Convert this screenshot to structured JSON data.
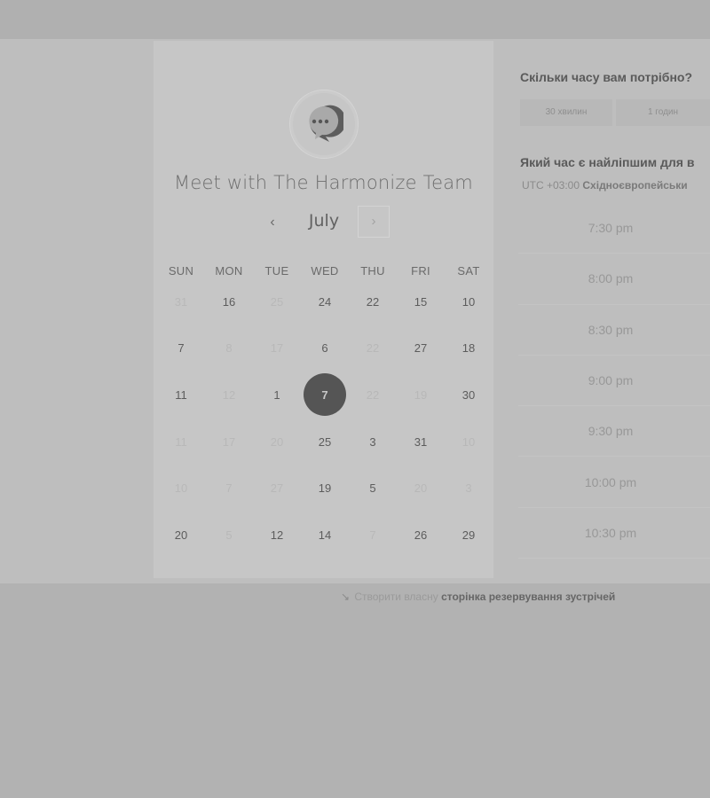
{
  "booking": {
    "title": "Meet with The Harmonize Team",
    "month": "July",
    "prev_icon": "‹",
    "next_icon": "›"
  },
  "calendar": {
    "weekdays": [
      "SUN",
      "MON",
      "TUE",
      "WED",
      "THU",
      "FRI",
      "SAT"
    ],
    "weeks": [
      [
        {
          "d": "31",
          "off": true
        },
        {
          "d": "16",
          "off": false
        },
        {
          "d": "25",
          "off": true
        },
        {
          "d": "24",
          "off": false
        },
        {
          "d": "22",
          "off": false
        },
        {
          "d": "15",
          "off": false
        },
        {
          "d": "10",
          "off": false
        }
      ],
      [
        {
          "d": "7",
          "off": false
        },
        {
          "d": "8",
          "off": true
        },
        {
          "d": "17",
          "off": true
        },
        {
          "d": "6",
          "off": false
        },
        {
          "d": "22",
          "off": true
        },
        {
          "d": "27",
          "off": false
        },
        {
          "d": "18",
          "off": false
        }
      ],
      [
        {
          "d": "11",
          "off": false
        },
        {
          "d": "12",
          "off": true
        },
        {
          "d": "1",
          "off": false
        },
        {
          "d": "7",
          "off": false,
          "selected": true
        },
        {
          "d": "22",
          "off": true
        },
        {
          "d": "19",
          "off": true
        },
        {
          "d": "30",
          "off": false
        }
      ],
      [
        {
          "d": "11",
          "off": true
        },
        {
          "d": "17",
          "off": true
        },
        {
          "d": "20",
          "off": true
        },
        {
          "d": "25",
          "off": false
        },
        {
          "d": "3",
          "off": false
        },
        {
          "d": "31",
          "off": false
        },
        {
          "d": "10",
          "off": true
        }
      ],
      [
        {
          "d": "10",
          "off": true
        },
        {
          "d": "7",
          "off": true
        },
        {
          "d": "27",
          "off": true
        },
        {
          "d": "19",
          "off": false
        },
        {
          "d": "5",
          "off": false
        },
        {
          "d": "20",
          "off": true
        },
        {
          "d": "3",
          "off": true
        }
      ],
      [
        {
          "d": "20",
          "off": false
        },
        {
          "d": "5",
          "off": true
        },
        {
          "d": "12",
          "off": false
        },
        {
          "d": "14",
          "off": false
        },
        {
          "d": "7",
          "off": true
        },
        {
          "d": "26",
          "off": false
        },
        {
          "d": "29",
          "off": false
        }
      ]
    ]
  },
  "duration": {
    "question": "Скільки часу вам потрібно?",
    "options": [
      "30 хвилин",
      "1 годин"
    ]
  },
  "time": {
    "question": "Який час є найліпшим для в",
    "timezone_prefix": "UTC +03:00",
    "timezone_name": "Східноєвропейськи",
    "slots": [
      "7:30 pm",
      "8:00 pm",
      "8:30 pm",
      "9:00 pm",
      "9:30 pm",
      "10:00 pm",
      "10:30 pm"
    ]
  },
  "footer": {
    "icon": "pointer-icon",
    "prefix": "Створити власну",
    "link": "сторінка резервування зустрічей"
  },
  "colors": {
    "background": "#b2b2b2",
    "card": "#c6c6c6",
    "selected_day": "#555555"
  }
}
